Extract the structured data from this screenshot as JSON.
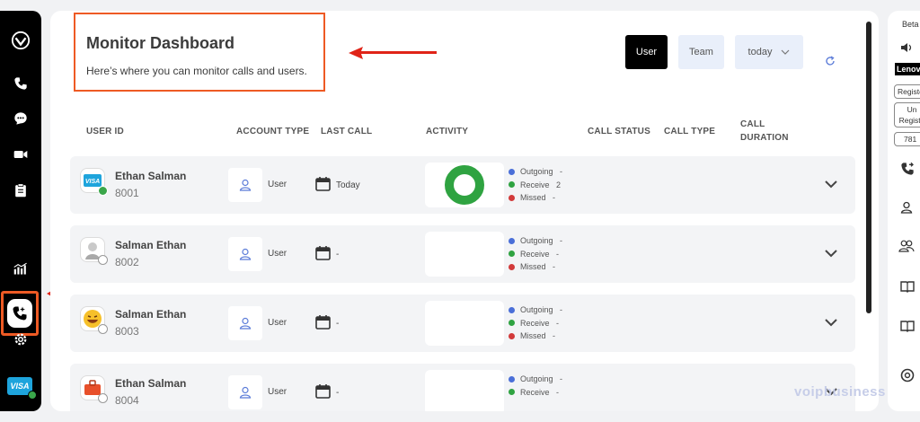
{
  "header": {
    "title": "Monitor Dashboard",
    "subtitle": "Here’s where you can monitor calls and users."
  },
  "toolbar": {
    "user_label": "User",
    "team_label": "Team",
    "period_label": "today"
  },
  "columns": [
    "USER ID",
    "ACCOUNT TYPE",
    "LAST CALL",
    "ACTIVITY",
    "CALL STATUS",
    "CALL TYPE",
    "CALL",
    "DURATION"
  ],
  "legend_labels": {
    "outgoing": "Outgoing",
    "receive": "Receive",
    "missed": "Missed"
  },
  "colors": {
    "outgoing": "#4a6fd8",
    "receive": "#2fa341",
    "missed": "#d23a3a",
    "accent": "#ee5a24",
    "donut": "#2fa341"
  },
  "rows": [
    {
      "name": "Ethan Salman",
      "ext": "8001",
      "account_type": "User",
      "last_call": "Today",
      "avatar": "visa-card-icon",
      "status": "online",
      "outgoing": "-",
      "receive": "2",
      "missed": "-",
      "has_donut": true
    },
    {
      "name": "Salman Ethan",
      "ext": "8002",
      "account_type": "User",
      "last_call": "-",
      "avatar": "person-photo-icon",
      "status": "offline",
      "outgoing": "-",
      "receive": "-",
      "missed": "-",
      "has_donut": false
    },
    {
      "name": "Salman Ethan",
      "ext": "8003",
      "account_type": "User",
      "last_call": "-",
      "avatar": "smiley-emoji-icon",
      "status": "offline",
      "outgoing": "-",
      "receive": "-",
      "missed": "-",
      "has_donut": false
    },
    {
      "name": "Ethan Salman",
      "ext": "8004",
      "account_type": "User",
      "last_call": "-",
      "avatar": "briefcase-emoji-icon",
      "status": "offline",
      "outgoing": "-",
      "receive": "-",
      "missed": null,
      "has_donut": false
    }
  ],
  "rail": {
    "visa_label": "VISA"
  },
  "right_panel": {
    "beta": "Beta",
    "device": "Lenovo",
    "pill_registered": "Registe",
    "pill_unregistered_1": "Un",
    "pill_unregistered_2": "Registe",
    "pill_ext": "781"
  },
  "watermark": "voipbusiness"
}
